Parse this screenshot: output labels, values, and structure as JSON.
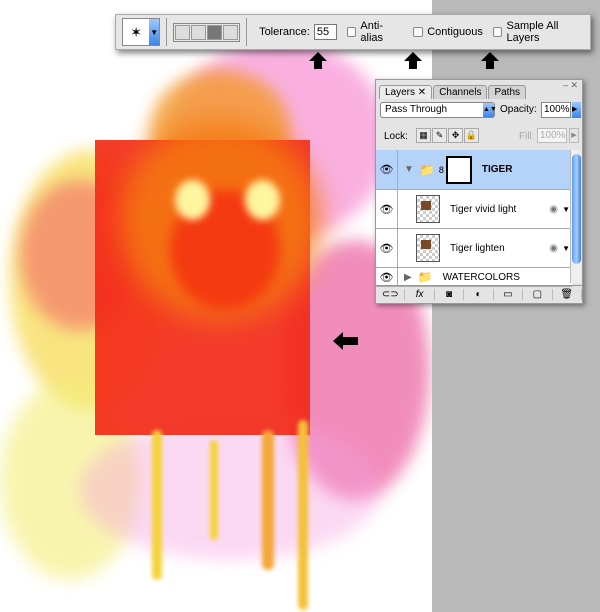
{
  "toolbar": {
    "tool": "magic-wand",
    "tolerance_label": "Tolerance:",
    "tolerance_value": "55",
    "anti_alias": "Anti-alias",
    "contiguous": "Contiguous",
    "sample_all": "Sample All Layers"
  },
  "panel": {
    "tabs": [
      "Layers",
      "Channels",
      "Paths"
    ],
    "blend_mode": "Pass Through",
    "opacity_label": "Opacity:",
    "opacity": "100%",
    "lock_label": "Lock:",
    "fill_label": "Fill:",
    "fill": "100%",
    "layers": [
      {
        "name": "TIGER",
        "type": "group",
        "expanded": true,
        "selected": true
      },
      {
        "name": "Tiger vivid light",
        "type": "smart-object"
      },
      {
        "name": "Tiger lighten",
        "type": "smart-object"
      },
      {
        "name": "WATERCOLORS",
        "type": "group",
        "expanded": false
      }
    ]
  },
  "colors": {
    "accent": "#3d86e6",
    "selection": "#b5d2f9",
    "canvas_bg": "#b9b9b9"
  }
}
